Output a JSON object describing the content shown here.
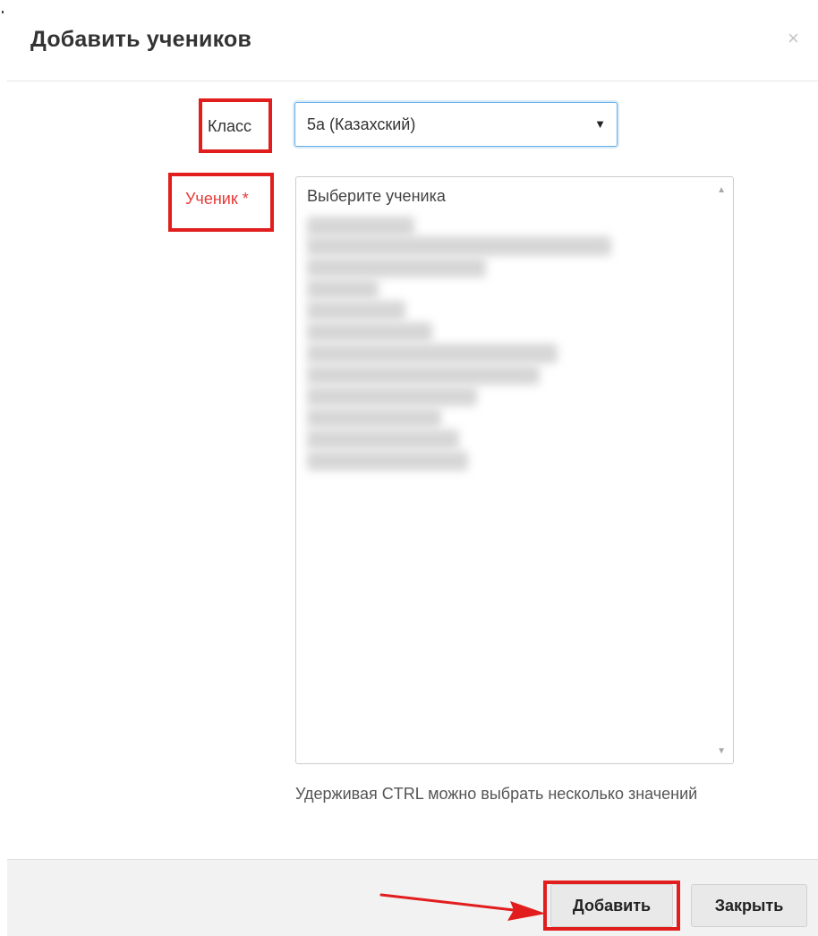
{
  "dialog": {
    "title": "Добавить учеников",
    "close_glyph": "×"
  },
  "form": {
    "class_label": "Класс",
    "class_value": "5a (Казахский)",
    "select_arrow": "▼",
    "student_label": "Ученик *",
    "student_placeholder": "Выберите ученика",
    "help_text": "Удерживая CTRL можно выбрать несколько значений"
  },
  "footer": {
    "add_label": "Добавить",
    "close_label": "Закрыть"
  },
  "annotations": {
    "highlight_color": "#e11d1d",
    "arrow_color": "#e11d1d",
    "required_label_color": "#e53935",
    "focus_border_color": "#66afe9"
  },
  "icons": {
    "close": "close-icon",
    "dropdown": "chevron-down-icon",
    "scroll_up": "scroll-up-icon",
    "scroll_down": "scroll-down-icon",
    "arrow": "pointer-arrow-icon"
  }
}
